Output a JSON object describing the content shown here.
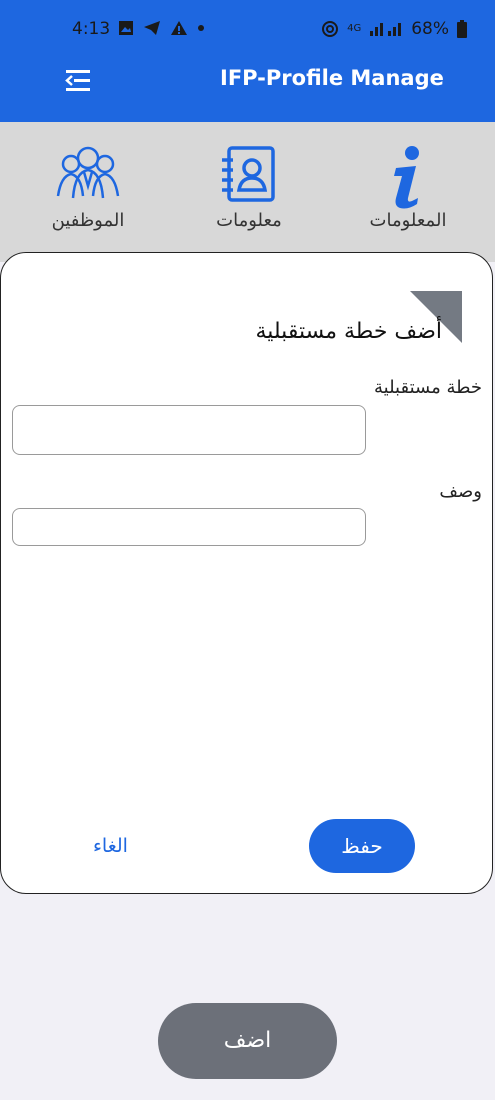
{
  "status_bar": {
    "time": "4:13",
    "network": "4G",
    "battery": "68%"
  },
  "app_bar": {
    "title": "IFP-Profile Manage"
  },
  "tabs": [
    {
      "label": "الموظفين",
      "icon": "people-group-icon"
    },
    {
      "label": "معلومات",
      "icon": "contact-book-icon"
    },
    {
      "label": "المعلومات",
      "icon": "info-icon"
    }
  ],
  "modal": {
    "title": "أضف خطة مستقبلية",
    "fields": [
      {
        "label": "خطة مستقبلية",
        "value": "",
        "placeholder": ""
      },
      {
        "label": "وصف",
        "value": "",
        "placeholder": ""
      }
    ],
    "save_label": "حفظ",
    "cancel_label": "الغاء"
  },
  "add_button_label": "اضف",
  "colors": {
    "primary": "#1e67e0",
    "tab_background": "#d8d8d8",
    "add_button": "#6c7079",
    "page_background": "#f1f0f6"
  }
}
